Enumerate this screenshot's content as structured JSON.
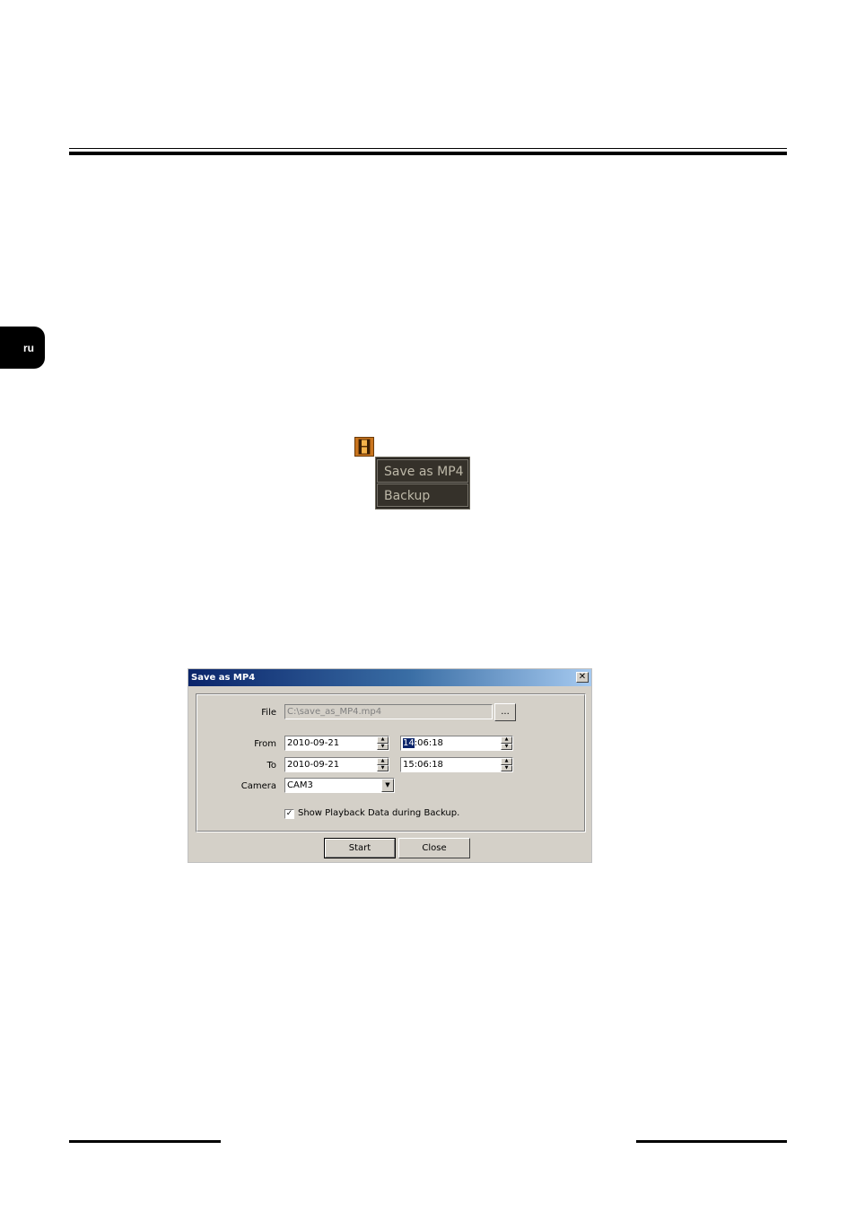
{
  "side_tab": {
    "lang": "ru"
  },
  "context_menu": {
    "icon": "film-icon",
    "items": [
      "Save as MP4",
      "Backup"
    ]
  },
  "dialog": {
    "title": "Save as MP4",
    "close_glyph": "✕",
    "file": {
      "label": "File",
      "value": "C:\\save_as_MP4.mp4",
      "browse_label": "..."
    },
    "from": {
      "label": "From",
      "date": "2010-09-21",
      "time_highlight": "14",
      "time_rest": ":06:18"
    },
    "to": {
      "label": "To",
      "date": "2010-09-21",
      "time": "15:06:18"
    },
    "camera": {
      "label": "Camera",
      "value": "CAM3"
    },
    "checkbox": {
      "label": "Show Playback Data during Backup.",
      "checked_glyph": "✓"
    },
    "buttons": {
      "start": "Start",
      "close": "Close"
    }
  }
}
